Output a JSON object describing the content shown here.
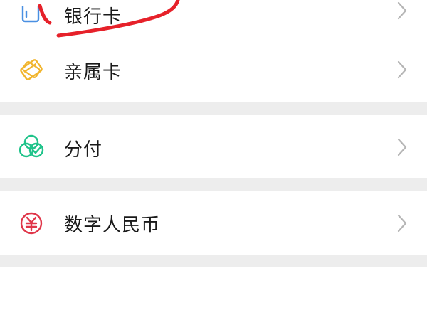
{
  "menu": {
    "items": [
      {
        "label": "银行卡",
        "icon": "bank-card-icon",
        "color": "#4a90e2"
      },
      {
        "label": "亲属卡",
        "icon": "family-card-icon",
        "color": "#f1b52e"
      },
      {
        "label": "分付",
        "icon": "installment-icon",
        "color": "#1fc38a"
      },
      {
        "label": "数字人民币",
        "icon": "digital-rmb-icon",
        "color": "#e0364a"
      }
    ]
  },
  "colors": {
    "background": "#ededed",
    "row": "#ffffff",
    "chevron": "#b5b5b5",
    "annotation": "#e6212a"
  }
}
